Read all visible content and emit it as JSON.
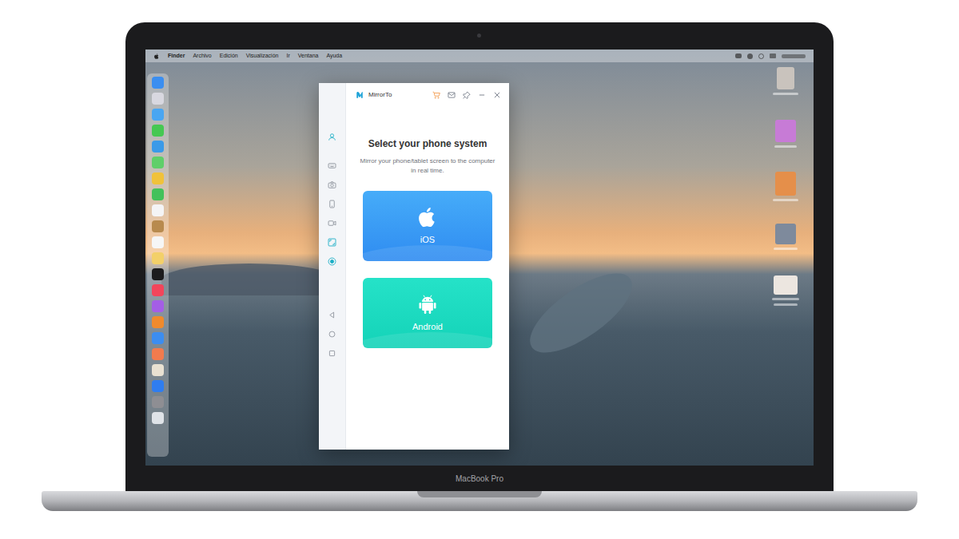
{
  "device": {
    "label": "MacBook Pro"
  },
  "menu_bar": {
    "items": [
      "Finder",
      "Archivo",
      "Edición",
      "Visualización",
      "Ir",
      "Ventana",
      "Ayuda"
    ]
  },
  "window": {
    "title": "MirrorTo",
    "sidebar": {
      "sections": [
        {
          "items": [
            {
              "kind": "user",
              "highlighted": true
            }
          ]
        },
        {
          "items": [
            {
              "kind": "keyboard",
              "highlighted": false
            },
            {
              "kind": "camera",
              "highlighted": false
            },
            {
              "kind": "phone",
              "highlighted": false
            },
            {
              "kind": "video",
              "highlighted": false
            },
            {
              "kind": "fullscreen",
              "highlighted": true
            },
            {
              "kind": "record",
              "highlighted": true
            }
          ]
        },
        {
          "items": [
            {
              "kind": "back",
              "highlighted": false
            },
            {
              "kind": "home",
              "highlighted": false
            },
            {
              "kind": "recent",
              "highlighted": false
            }
          ]
        }
      ]
    },
    "heading": "Select your phone system",
    "subtitle": "Mirror your phone/tablet screen to the computer in real time.",
    "options": [
      {
        "label": "iOS",
        "kind": "ios"
      },
      {
        "label": "Android",
        "kind": "android"
      }
    ]
  }
}
